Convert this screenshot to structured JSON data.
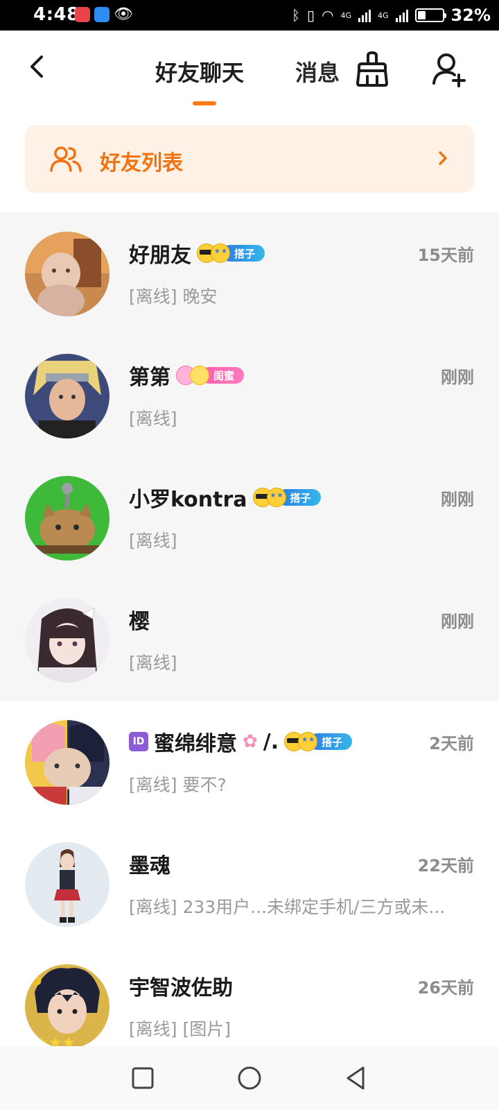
{
  "status_bar": {
    "time": "4:48",
    "battery_percent": "32%",
    "battery_level": 0.32,
    "network_label_1": "4G",
    "network_label_2": "4G"
  },
  "header": {
    "tabs": [
      {
        "label": "好友聊天",
        "active": true
      },
      {
        "label": "消息",
        "active": false
      }
    ],
    "accent_color": "#ff7a18"
  },
  "friend_list": {
    "label": "好友列表",
    "color": "#f07312",
    "background": "#fff1e6"
  },
  "chats": [
    {
      "name": "好朋友",
      "badge": "搭子",
      "badge_style": "blue",
      "time": "15天前",
      "preview": "[离线] 晚安",
      "pinned": true
    },
    {
      "name": "第第",
      "badge": "闺蜜",
      "badge_style": "pink",
      "time": "刚刚",
      "preview": "[离线]",
      "pinned": true
    },
    {
      "name": "小罗kontra",
      "badge": "搭子",
      "badge_style": "blue",
      "time": "刚刚",
      "preview": "[离线]",
      "pinned": true
    },
    {
      "name": "樱",
      "badge": "",
      "badge_style": "",
      "time": "刚刚",
      "preview": "[离线]",
      "pinned": true
    },
    {
      "name": "蜜绵绯意",
      "name_suffix": "/.",
      "id_icon": "ID",
      "badge": "搭子",
      "badge_style": "blue",
      "time": "2天前",
      "preview": "[离线] 要不?",
      "pinned": false
    },
    {
      "name": "墨魂",
      "badge": "",
      "badge_style": "",
      "time": "22天前",
      "preview": "[离线] 233用户...未绑定手机/三方或未...",
      "pinned": false
    },
    {
      "name": "宇智波佐助",
      "badge": "",
      "badge_style": "",
      "time": "26天前",
      "preview": "[离线] [图片]",
      "pinned": false
    }
  ],
  "icons": {
    "back": "chevron-left-icon",
    "clean": "broom-icon",
    "add_friend": "add-user-icon",
    "friends": "people-icon",
    "chevron": "chevron-right-icon"
  },
  "colors": {
    "pinned_background": "#f6f6f6",
    "time_color": "#8c8c8c",
    "preview_color": "#9a9a9a"
  }
}
